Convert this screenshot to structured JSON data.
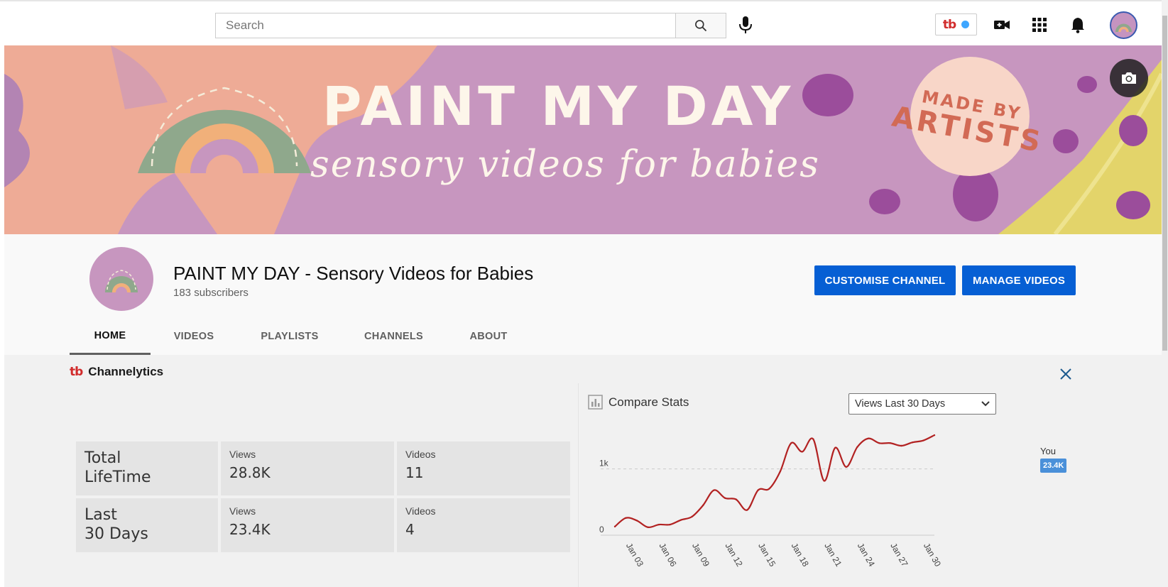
{
  "search": {
    "placeholder": "Search"
  },
  "extension": {
    "logo": "tb"
  },
  "icons": {
    "search": "search-icon",
    "mic": "microphone-icon",
    "create": "video-camera-icon",
    "apps": "apps-grid-icon",
    "notifications": "bell-icon",
    "camera": "camera-icon",
    "close": "close-icon",
    "chart": "bar-chart-icon",
    "dropdown": "chevron-down-icon"
  },
  "banner": {
    "headline": "PAINT MY DAY",
    "tagline": "sensory videos for babies",
    "badge_line1": "MADE BY",
    "badge_line2": "ARTISTS"
  },
  "channel": {
    "title": "PAINT MY DAY - Sensory Videos for Babies",
    "subscribers": "183 subscribers",
    "customise_label": "CUSTOMISE CHANNEL",
    "manage_label": "MANAGE VIDEOS"
  },
  "tabs": [
    {
      "label": "HOME",
      "active": true
    },
    {
      "label": "VIDEOS",
      "active": false
    },
    {
      "label": "PLAYLISTS",
      "active": false
    },
    {
      "label": "CHANNELS",
      "active": false
    },
    {
      "label": "ABOUT",
      "active": false
    }
  ],
  "channelytics": {
    "logo": "tb",
    "title": "Channelytics",
    "stats": [
      {
        "period": "Total\nLifeTime",
        "views_label": "Views",
        "views": "28.8K",
        "videos_label": "Videos",
        "videos": "11"
      },
      {
        "period": "Last\n30 Days",
        "views_label": "Views",
        "views": "23.4K",
        "videos_label": "Videos",
        "videos": "4"
      }
    ],
    "compare": {
      "title": "Compare Stats",
      "select_value": "Views Last 30 Days",
      "legend_label": "You",
      "legend_value": "23.4K"
    }
  },
  "colors": {
    "accent_blue": "#065fd4",
    "line_red": "#b22222",
    "brand_red": "#d12c2c",
    "banner_lilac": "#c796bf",
    "banner_peach": "#eeab96"
  },
  "chart_data": {
    "type": "line",
    "x_tick_labels": [
      "Jan 03",
      "Jan 06",
      "Jan 09",
      "Jan 12",
      "Jan 15",
      "Jan 18",
      "Jan 21",
      "Jan 24",
      "Jan 27",
      "Jan 30"
    ],
    "y_tick_labels": [
      "0",
      "1k"
    ],
    "ylim": [
      0,
      1500
    ],
    "x": [
      "Jan 02",
      "Jan 03",
      "Jan 04",
      "Jan 05",
      "Jan 06",
      "Jan 07",
      "Jan 08",
      "Jan 09",
      "Jan 10",
      "Jan 11",
      "Jan 12",
      "Jan 13",
      "Jan 14",
      "Jan 15",
      "Jan 16",
      "Jan 17",
      "Jan 18",
      "Jan 19",
      "Jan 20",
      "Jan 21",
      "Jan 22",
      "Jan 23",
      "Jan 24",
      "Jan 25",
      "Jan 26",
      "Jan 27",
      "Jan 28",
      "Jan 29",
      "Jan 30",
      "Jan 31"
    ],
    "series": [
      {
        "values": [
          130,
          260,
          220,
          120,
          160,
          160,
          230,
          280,
          450,
          680,
          560,
          540,
          380,
          680,
          700,
          960,
          1390,
          1260,
          1450,
          820,
          1320,
          1030,
          1330,
          1460,
          1390,
          1390,
          1350,
          1400,
          1430,
          1510
        ]
      }
    ],
    "grid": "dashed horizontal at 1k",
    "xlabel": "",
    "ylabel": ""
  }
}
